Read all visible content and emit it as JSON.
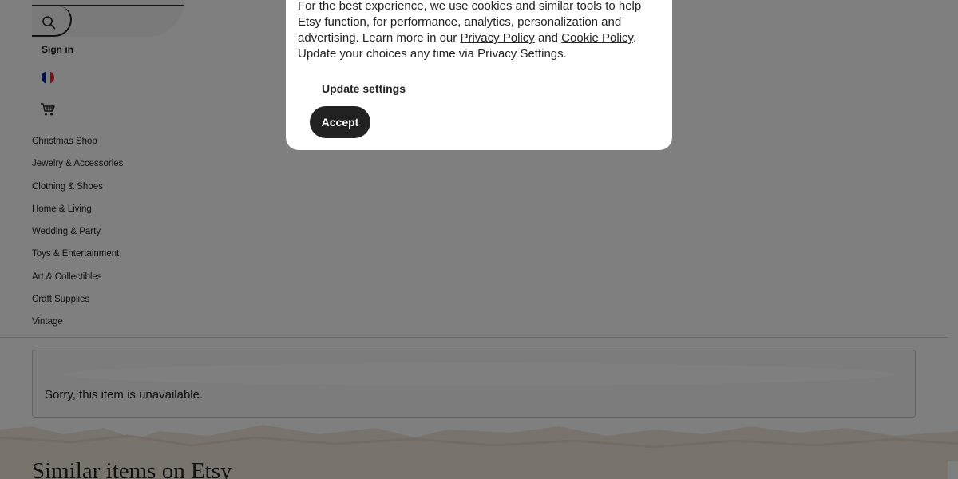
{
  "header": {
    "search_icon": "search-icon",
    "sign_in_label": "Sign in",
    "region_flag": "france-flag-icon",
    "cart_icon": "cart-icon"
  },
  "categories": [
    "Christmas Shop",
    "Jewelry & Accessories",
    "Clothing & Shoes",
    "Home & Living",
    "Wedding & Party",
    "Toys & Entertainment",
    "Art & Collectibles",
    "Craft Supplies",
    "Vintage"
  ],
  "notice": {
    "message": "Sorry, this item is unavailable."
  },
  "similar": {
    "title": "Similar items on Etsy"
  },
  "cookie_dialog": {
    "text_1": "For the best experience, we use cookies and similar tools to help Etsy function, for performance, analytics, personalization and advertising. Learn more in our ",
    "privacy_link": "Privacy Policy",
    "text_2": " and ",
    "cookie_link": "Cookie Policy",
    "text_3": ". Update your choices any time via Privacy Settings.",
    "update_settings_label": "Update settings",
    "accept_label": "Accept"
  },
  "colors": {
    "text": "#222222",
    "overlay": "rgba(0,0,0,0.5)",
    "accept_bg": "#222222",
    "band": "#f2e7dd",
    "flag_blue": "#002395",
    "flag_white": "#ffffff",
    "flag_red": "#ed2939"
  }
}
